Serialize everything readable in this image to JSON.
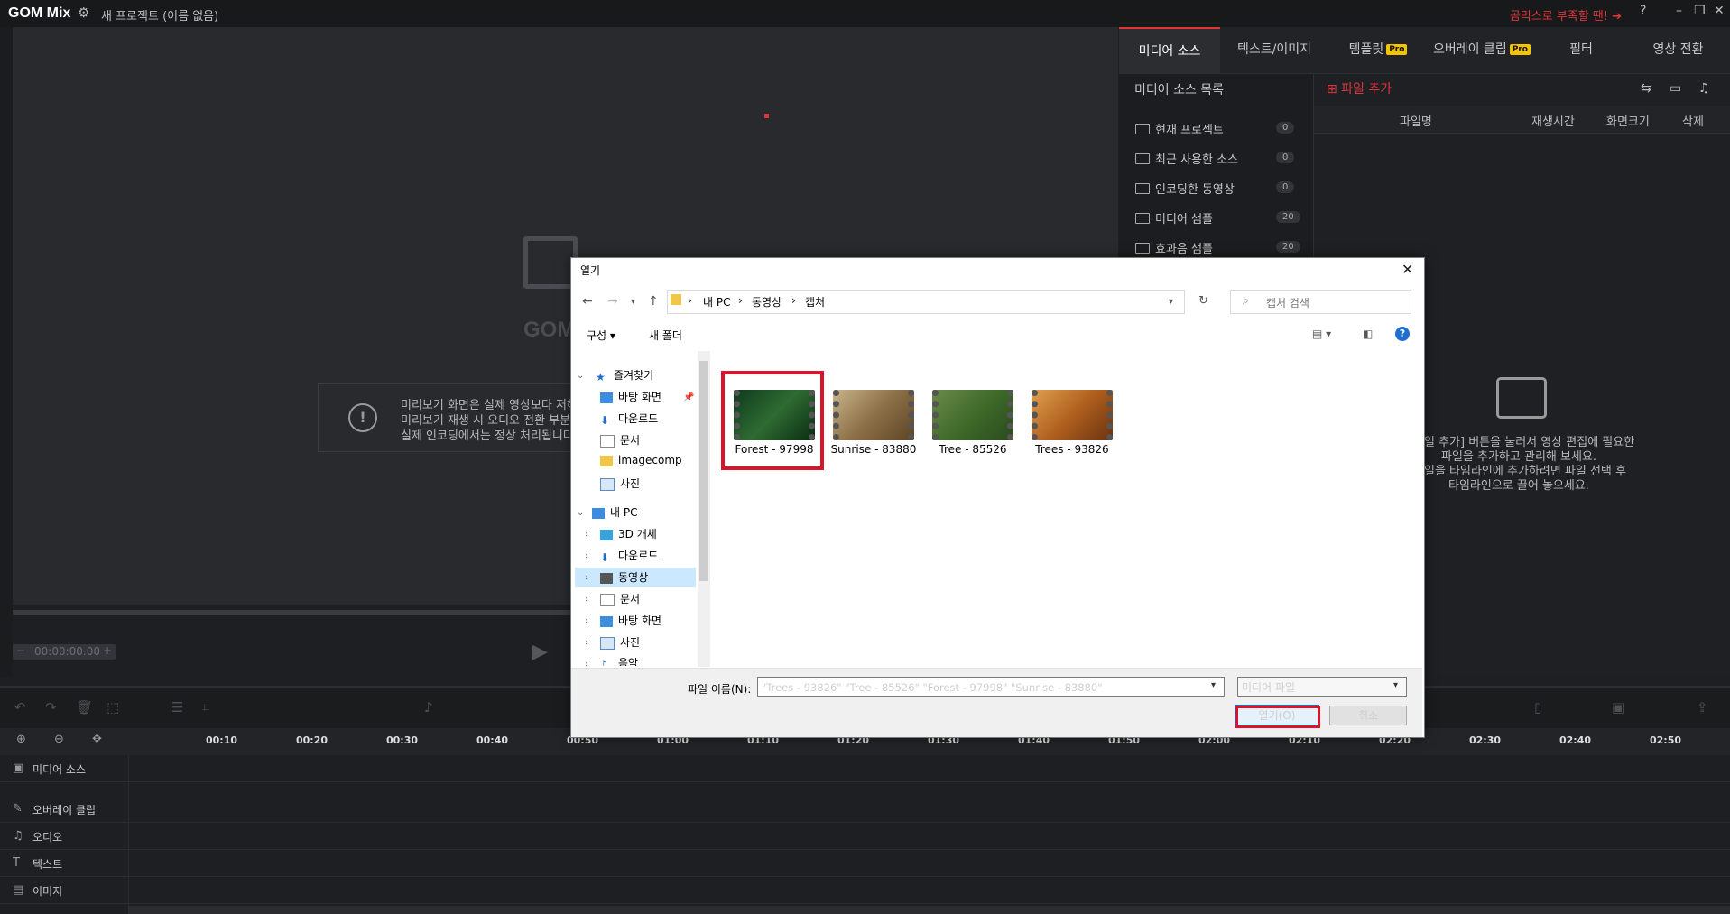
{
  "app": {
    "logo": "GOM Mix",
    "project_title": "새 프로젝트 (이름 없음)",
    "promo": "곰믹스로 부족할 땐! ➔",
    "help": "?",
    "minimize": "–",
    "maximize": "❐",
    "close": "✕"
  },
  "preview": {
    "watermark": "GOM",
    "notice_lines": [
      "미리보기 화면은 실제 영상보다 저하",
      "미리보기 재생 시 오디오 전환 부분",
      "실제 인코딩에서는 정상 처리됩니다"
    ],
    "timecode": "00:00:00.00"
  },
  "right_tabs": [
    {
      "label": "미디어 소스",
      "pro": false
    },
    {
      "label": "텍스트/이미지",
      "pro": false
    },
    {
      "label": "템플릿",
      "pro": true
    },
    {
      "label": "오버레이 클립",
      "pro": true
    },
    {
      "label": "필터",
      "pro": false
    },
    {
      "label": "영상 전환",
      "pro": false
    }
  ],
  "pro_badge": "Pro",
  "source_list": {
    "title": "미디어 소스 목록",
    "items": [
      {
        "label": "현재 프로젝트",
        "count": "0"
      },
      {
        "label": "최근 사용한 소스",
        "count": "0"
      },
      {
        "label": "인코딩한 동영상",
        "count": "0"
      },
      {
        "label": "미디어 샘플",
        "count": "20"
      },
      {
        "label": "효과음 샘플",
        "count": "20"
      }
    ]
  },
  "media_table": {
    "add_file": "파일 추가",
    "headers": [
      "파일명",
      "재생시간",
      "화면크기",
      "삭제"
    ],
    "empty_lines": [
      "일 추가] 버튼을 눌러서 영상 편집에 필요한",
      "파일을 추가하고 관리해 보세요.",
      "일을 타임라인에 추가하려면 파일 선택 후",
      "타임라인으로 끌어 놓으세요."
    ]
  },
  "timeline": {
    "ticks": [
      "00:10",
      "00:20",
      "00:30",
      "00:40",
      "00:50",
      "01:00",
      "01:10",
      "01:20",
      "01:30",
      "01:40",
      "01:50",
      "02:00",
      "02:10",
      "02:20",
      "02:30",
      "02:40",
      "02:50"
    ],
    "tracks": [
      {
        "label": "미디어 소스",
        "icon": "film-icon"
      },
      {
        "label": "오버레이 클립",
        "icon": "brush-icon"
      },
      {
        "label": "오디오",
        "icon": "music-icon"
      },
      {
        "label": "텍스트",
        "icon": "text-icon"
      },
      {
        "label": "이미지",
        "icon": "image-icon"
      }
    ]
  },
  "dialog": {
    "title": "열기",
    "breadcrumb": [
      "내 PC",
      "동영상",
      "캡처"
    ],
    "search_placeholder": "캡처 검색",
    "organize": "구성 ▾",
    "new_folder": "새 폴더",
    "nav": {
      "quick_access": "즐겨찾기",
      "quick_items": [
        "바탕 화면",
        "다운로드",
        "문서",
        "imagecompre",
        "사진"
      ],
      "this_pc": "내 PC",
      "pc_items": [
        "3D 개체",
        "다운로드",
        "동영상",
        "문서",
        "바탕 화면",
        "사진",
        "음악"
      ]
    },
    "files": [
      "Forest - 97998",
      "Sunrise - 83880",
      "Tree - 85526",
      "Trees - 93826"
    ],
    "filename_label": "파일 이름(N):",
    "filename_value": "\"Trees - 93826\" \"Tree - 85526\" \"Forest - 97998\" \"Sunrise - 83880\"",
    "filetype": "미디어 파일",
    "open_button": "열기(O)",
    "cancel_button": "취소"
  },
  "colors": {
    "accent": "#e0363b",
    "highlight": "#d9152b",
    "selection": "#cce8ff"
  }
}
